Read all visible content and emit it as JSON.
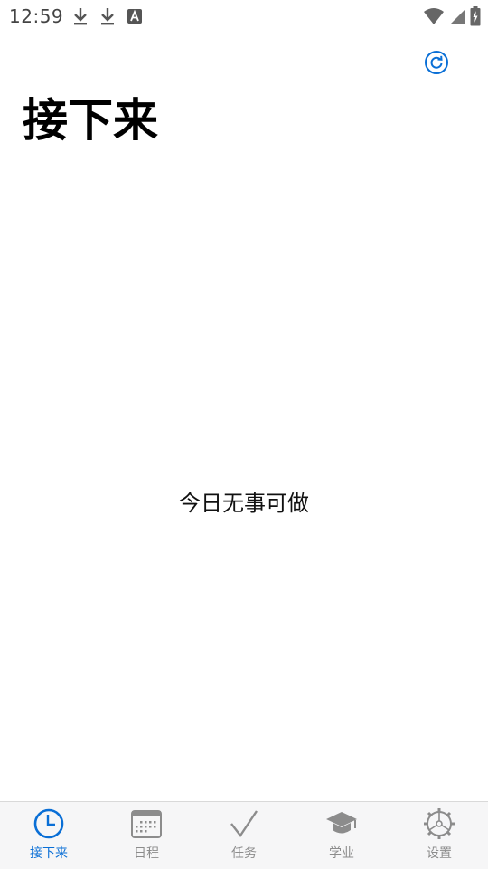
{
  "status_bar": {
    "time": "12:59",
    "icons_left": [
      "download-icon",
      "download-icon",
      "keyboard-a-icon"
    ],
    "icons_right": [
      "wifi-icon",
      "cell-signal-icon",
      "battery-charging-icon"
    ]
  },
  "header": {
    "title": "接下来",
    "refresh_icon": "refresh-icon"
  },
  "main": {
    "empty_message": "今日无事可做"
  },
  "tabs": [
    {
      "label": "接下来",
      "icon": "clock-icon",
      "active": true
    },
    {
      "label": "日程",
      "icon": "calendar-icon",
      "active": false
    },
    {
      "label": "任务",
      "icon": "checkmark-icon",
      "active": false
    },
    {
      "label": "学业",
      "icon": "graduation-cap-icon",
      "active": false
    },
    {
      "label": "设置",
      "icon": "gear-icon",
      "active": false
    }
  ],
  "colors": {
    "accent": "#0a6fd6",
    "inactive": "#8c8c8c",
    "tab_bar_bg": "#f6f6f7"
  }
}
